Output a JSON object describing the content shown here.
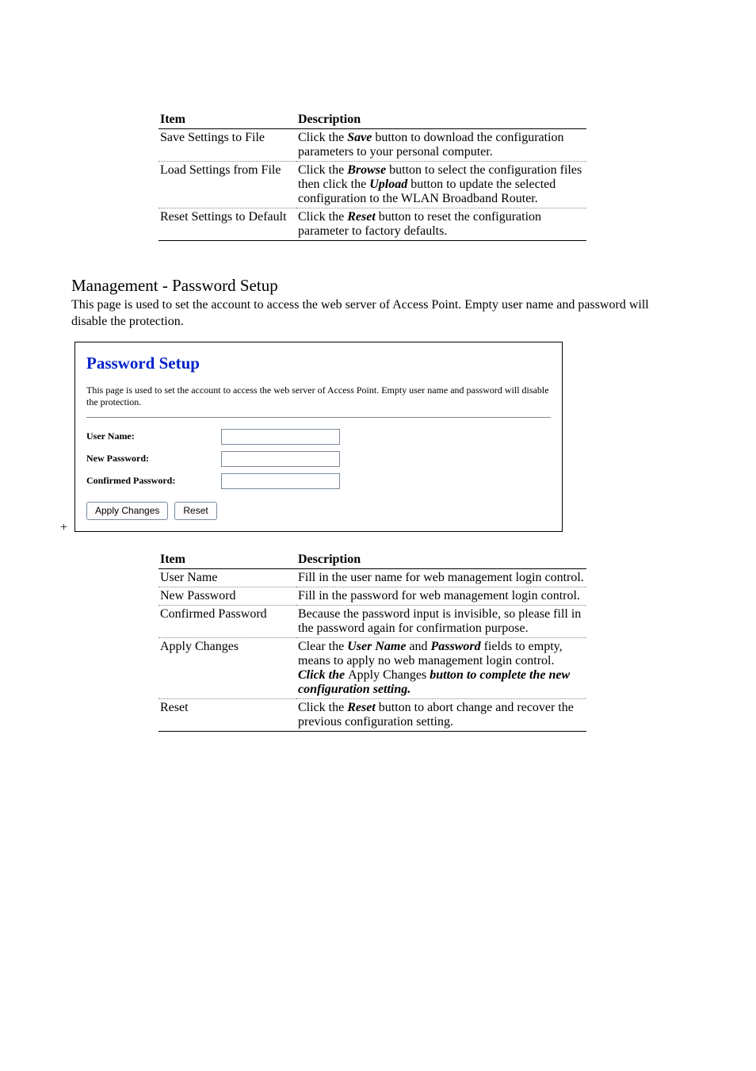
{
  "table1": {
    "headers": {
      "item": "Item",
      "desc": "Description"
    },
    "rows": [
      {
        "item": "Save Settings to File",
        "desc_parts": [
          "Click the ",
          "Save",
          " button to download the configuration parameters to your personal computer."
        ]
      },
      {
        "item": "Load Settings from File",
        "desc_parts": [
          "Click the ",
          "Browse",
          " button to select the configuration files then click the ",
          "Upload",
          " button to update the selected configuration to the WLAN Broadband Router."
        ]
      },
      {
        "item": "Reset Settings to Default",
        "desc_parts": [
          "Click the ",
          "Reset",
          " button to reset the configuration parameter to factory defaults."
        ]
      }
    ]
  },
  "section": {
    "heading": "Management - Password Setup",
    "intro": "This page is used to set the account to access the web server of Access Point. Empty user name and password will disable the protection."
  },
  "panel": {
    "title": "Password Setup",
    "desc": "This page is used to set the account to access the web server of Access Point. Empty user name and password will disable the protection.",
    "labels": {
      "username": "User Name:",
      "newpass": "New Password:",
      "confirmed": "Confirmed Password:"
    },
    "buttons": {
      "apply": "Apply Changes",
      "reset": "Reset"
    }
  },
  "plus": "+",
  "table2": {
    "headers": {
      "item": "Item",
      "desc": "Description"
    },
    "rows": [
      {
        "item": "User Name",
        "desc_parts": [
          "Fill in the user name for web management login control."
        ]
      },
      {
        "item": "New Password",
        "desc_parts": [
          "Fill in the password for web management login control."
        ]
      },
      {
        "item": "Confirmed Password",
        "desc_parts": [
          "Because the password input is invisible, so please fill in the password again for confirmation purpose."
        ]
      },
      {
        "item": "Apply Changes",
        "desc_parts": [
          "Clear the ",
          "User Name",
          " and ",
          "Password",
          " fields to empty, means to apply no web management login control.",
          "<br>",
          "Click the ",
          "Apply Changes",
          " button to complete the new configuration setting."
        ]
      },
      {
        "item": "Reset",
        "desc_parts": [
          "Click the ",
          "Reset",
          " button to abort change and recover the previous configuration setting."
        ]
      }
    ]
  }
}
